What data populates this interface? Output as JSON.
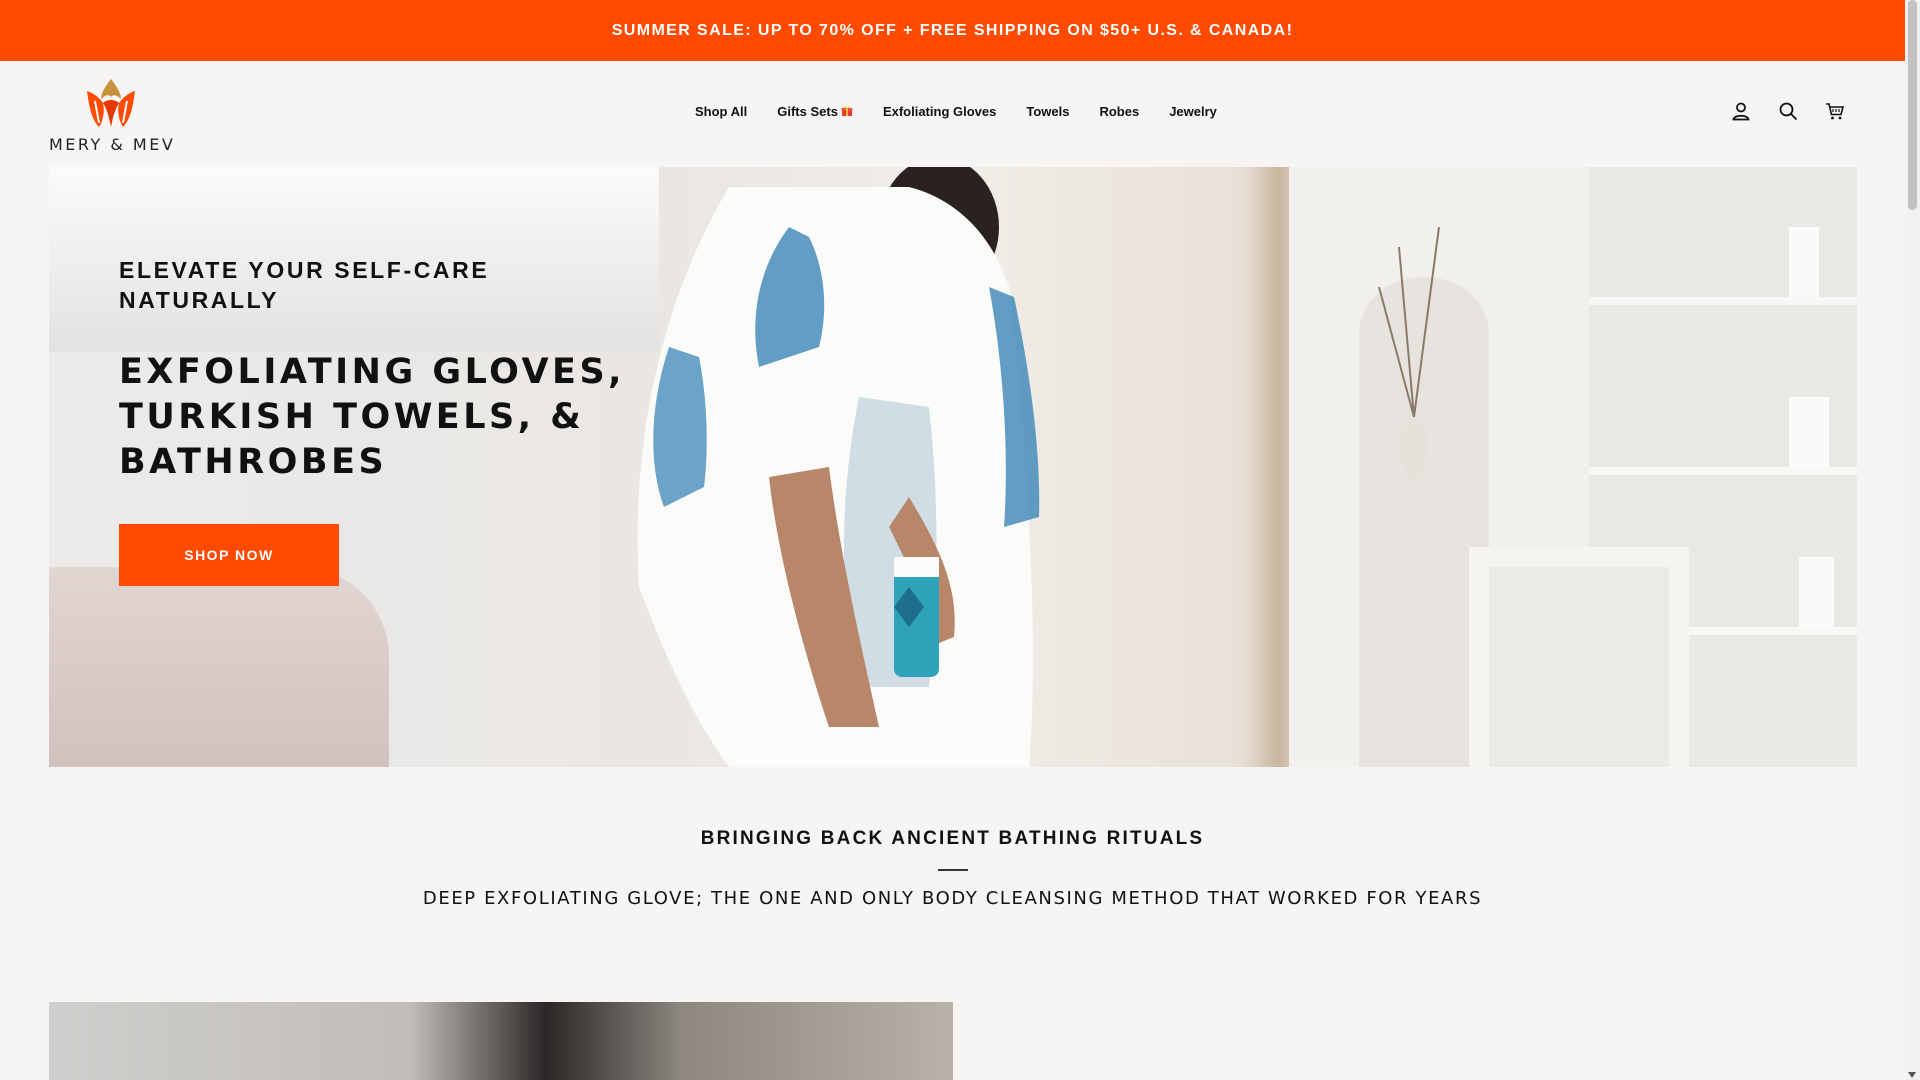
{
  "announcement": {
    "text": "SUMMER SALE: UP TO 70% OFF + FREE SHIPPING ON $50+ U.S. & CANADA!"
  },
  "header": {
    "logo_text": "MERY & MEV",
    "nav": [
      {
        "label": "Shop All"
      },
      {
        "label": "Gifts Sets",
        "icon": "gift-icon"
      },
      {
        "label": "Exfoliating Gloves"
      },
      {
        "label": "Towels"
      },
      {
        "label": "Robes"
      },
      {
        "label": "Jewelry"
      }
    ],
    "icons": [
      "account-icon",
      "search-icon",
      "cart-icon"
    ]
  },
  "hero": {
    "eyebrow": "ELEVATE YOUR SELF-CARE NATURALLY",
    "title_lines": [
      "EXFOLIATING GLOVES,",
      "TURKISH TOWELS, &",
      "BATHROBES"
    ],
    "button_label": "SHOP NOW"
  },
  "section": {
    "title": "BRINGING BACK ANCIENT BATHING RITUALS",
    "subtitle": "DEEP EXFOLIATING GLOVE; THE ONE AND ONLY BODY CLEANSING METHOD THAT WORKED FOR YEARS"
  },
  "colors": {
    "accent": "#ff4a00",
    "background": "#f6f5f4",
    "text": "#111111"
  }
}
